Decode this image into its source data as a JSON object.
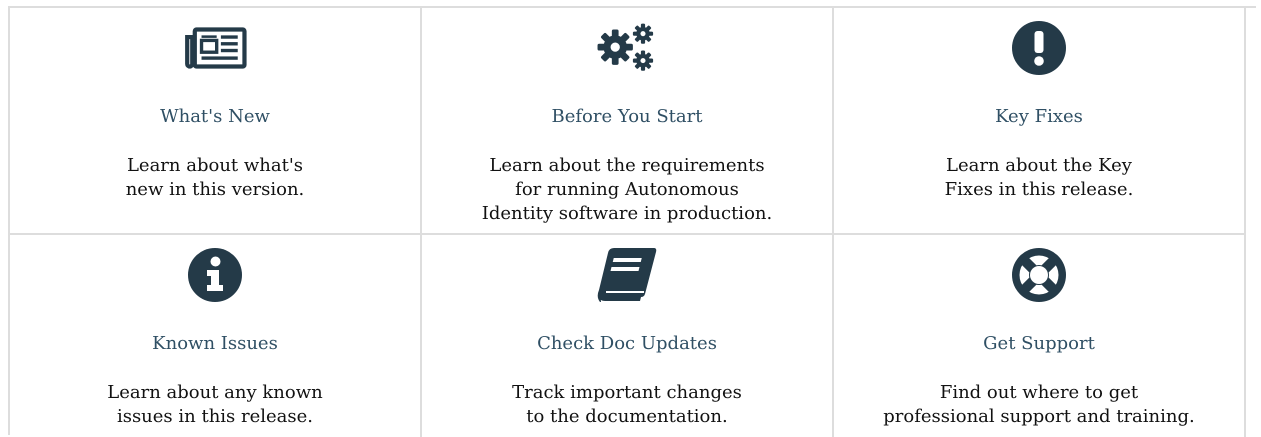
{
  "colors": {
    "icon": "#243a48",
    "title_link": "#2f4f64",
    "text": "#111111",
    "divider": "#dddddd"
  },
  "cards": [
    {
      "icon": "newspaper-icon",
      "title": "What's New",
      "description": "Learn about what's\nnew in this version."
    },
    {
      "icon": "gears-icon",
      "title": "Before You Start",
      "description": "Learn about the requirements\nfor running Autonomous\nIdentity software in production."
    },
    {
      "icon": "exclamation-circle-icon",
      "title": "Key Fixes",
      "description": "Learn about the Key\nFixes in this release."
    },
    {
      "icon": "info-circle-icon",
      "title": "Known Issues",
      "description": "Learn about any known\nissues in this release."
    },
    {
      "icon": "book-icon",
      "title": "Check Doc Updates",
      "description": "Track important changes\nto the documentation."
    },
    {
      "icon": "life-ring-icon",
      "title": "Get Support",
      "description": "Find out where to get\nprofessional support and training."
    }
  ]
}
